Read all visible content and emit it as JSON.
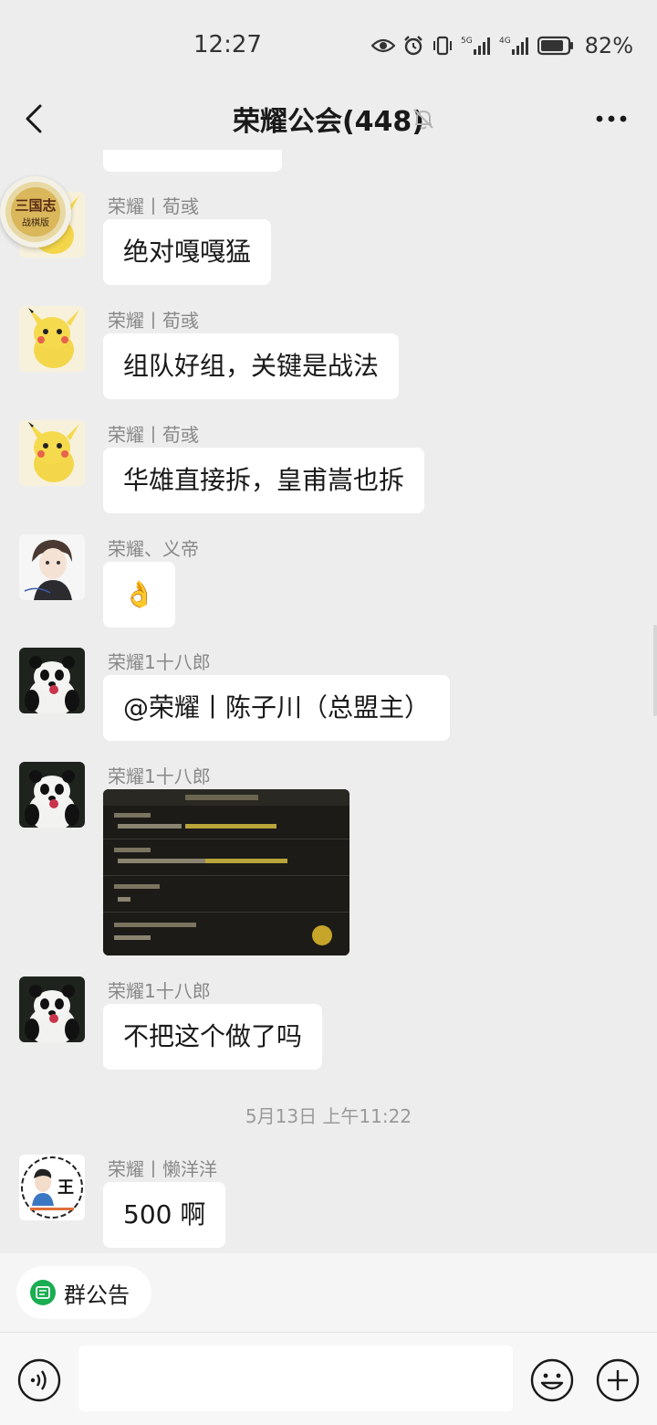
{
  "status_bar": {
    "time": "12:27",
    "battery": "82%",
    "net_5g": "5G",
    "net_4g": "4G"
  },
  "header": {
    "title": "荣耀公会(448)"
  },
  "badge": {
    "title": "三国志",
    "subtitle": "战棋版"
  },
  "messages": [
    {
      "sender": "荣耀丨荀彧",
      "text": "绝对嘎嘎猛",
      "avatar": "pikachu"
    },
    {
      "sender": "荣耀丨荀彧",
      "text": "组队好组，关键是战法",
      "avatar": "pikachu"
    },
    {
      "sender": "荣耀丨荀彧",
      "text": "华雄直接拆，皇甫嵩也拆",
      "avatar": "pikachu"
    },
    {
      "sender": "荣耀、义帝",
      "text": "👌",
      "avatar": "anime-boy"
    },
    {
      "sender": "荣耀1十八郎",
      "text": "@荣耀丨陈子川（总盟主）",
      "avatar": "panda"
    },
    {
      "sender": "荣耀1十八郎",
      "text": "",
      "avatar": "panda",
      "type": "image"
    },
    {
      "sender": "荣耀1十八郎",
      "text": "不把这个做了吗",
      "avatar": "panda"
    },
    {
      "sender": "荣耀丨懒洋洋",
      "text": "500 啊",
      "avatar": "wang"
    }
  ],
  "time_separator": "5月13日 上午11:22",
  "wang_avatar_char": "王",
  "notice": {
    "label": "群公告"
  },
  "input": {
    "value": ""
  },
  "colors": {
    "background": "#ededed",
    "bubble": "#ffffff",
    "notice_icon": "#1aad52"
  }
}
